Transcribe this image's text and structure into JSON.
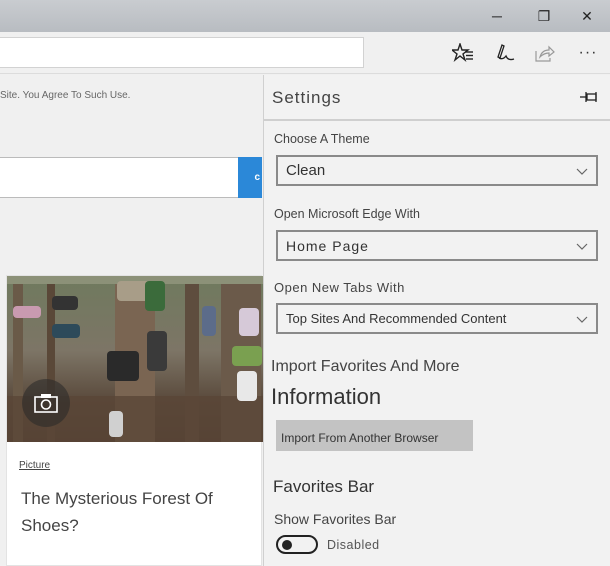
{
  "window": {
    "controls": {
      "minimize_glyph": "─",
      "maximize_glyph": "❐",
      "close_glyph": "✕"
    }
  },
  "toolbar": {
    "address_value": "",
    "icons": [
      "hub-favorites-icon",
      "web-note-icon",
      "share-icon",
      "more-icon"
    ],
    "more_label": "···"
  },
  "page": {
    "cookie_notice": "Site. You Agree To Such Use.",
    "search": {
      "value": "",
      "button_label": "c"
    },
    "card": {
      "category": "Picture",
      "title": "The Mysterious Forest Of Shoes?",
      "image_alt": "Shoes hanging on trees in a forest",
      "badge_icon": "camera-icon"
    }
  },
  "settings": {
    "title": "Settings",
    "pin_icon": "pin-icon",
    "theme": {
      "label": "Choose A Theme",
      "selected": "Clean"
    },
    "open_with": {
      "label": "Open Microsoft Edge With",
      "selected": "Home Page"
    },
    "new_tabs": {
      "label": "Open New Tabs With",
      "selected": "Top Sites And Recommended Content"
    },
    "import": {
      "title_line1": "Import Favorites And More",
      "title_line2": "Information",
      "button_label": "Import From Another Browser"
    },
    "favorites_bar": {
      "title": "Favorites Bar",
      "label": "Show Favorites Bar",
      "toggle_state": "Disabled",
      "toggle_on": false
    }
  },
  "colors": {
    "accent": "#2b88d8",
    "panel_bg": "#f2f2f2",
    "button_gray": "#c3c3c3"
  }
}
